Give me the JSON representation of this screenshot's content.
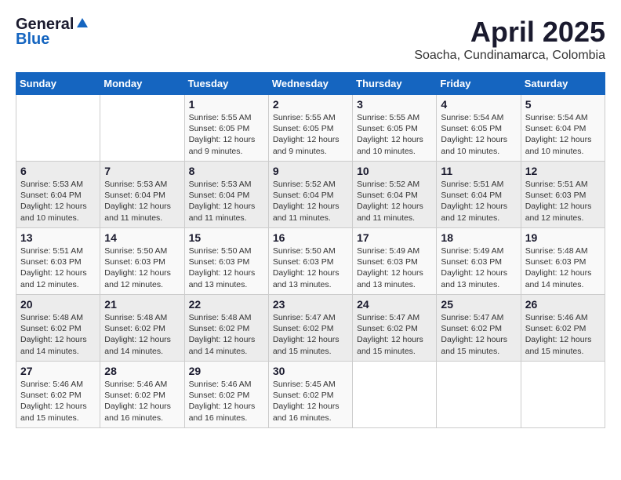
{
  "header": {
    "logo_general": "General",
    "logo_blue": "Blue",
    "title": "April 2025",
    "subtitle": "Soacha, Cundinamarca, Colombia"
  },
  "columns": [
    "Sunday",
    "Monday",
    "Tuesday",
    "Wednesday",
    "Thursday",
    "Friday",
    "Saturday"
  ],
  "weeks": [
    [
      {
        "day": "",
        "detail": ""
      },
      {
        "day": "",
        "detail": ""
      },
      {
        "day": "1",
        "detail": "Sunrise: 5:55 AM\nSunset: 6:05 PM\nDaylight: 12 hours\nand 9 minutes."
      },
      {
        "day": "2",
        "detail": "Sunrise: 5:55 AM\nSunset: 6:05 PM\nDaylight: 12 hours\nand 9 minutes."
      },
      {
        "day": "3",
        "detail": "Sunrise: 5:55 AM\nSunset: 6:05 PM\nDaylight: 12 hours\nand 10 minutes."
      },
      {
        "day": "4",
        "detail": "Sunrise: 5:54 AM\nSunset: 6:05 PM\nDaylight: 12 hours\nand 10 minutes."
      },
      {
        "day": "5",
        "detail": "Sunrise: 5:54 AM\nSunset: 6:04 PM\nDaylight: 12 hours\nand 10 minutes."
      }
    ],
    [
      {
        "day": "6",
        "detail": "Sunrise: 5:53 AM\nSunset: 6:04 PM\nDaylight: 12 hours\nand 10 minutes."
      },
      {
        "day": "7",
        "detail": "Sunrise: 5:53 AM\nSunset: 6:04 PM\nDaylight: 12 hours\nand 11 minutes."
      },
      {
        "day": "8",
        "detail": "Sunrise: 5:53 AM\nSunset: 6:04 PM\nDaylight: 12 hours\nand 11 minutes."
      },
      {
        "day": "9",
        "detail": "Sunrise: 5:52 AM\nSunset: 6:04 PM\nDaylight: 12 hours\nand 11 minutes."
      },
      {
        "day": "10",
        "detail": "Sunrise: 5:52 AM\nSunset: 6:04 PM\nDaylight: 12 hours\nand 11 minutes."
      },
      {
        "day": "11",
        "detail": "Sunrise: 5:51 AM\nSunset: 6:04 PM\nDaylight: 12 hours\nand 12 minutes."
      },
      {
        "day": "12",
        "detail": "Sunrise: 5:51 AM\nSunset: 6:03 PM\nDaylight: 12 hours\nand 12 minutes."
      }
    ],
    [
      {
        "day": "13",
        "detail": "Sunrise: 5:51 AM\nSunset: 6:03 PM\nDaylight: 12 hours\nand 12 minutes."
      },
      {
        "day": "14",
        "detail": "Sunrise: 5:50 AM\nSunset: 6:03 PM\nDaylight: 12 hours\nand 12 minutes."
      },
      {
        "day": "15",
        "detail": "Sunrise: 5:50 AM\nSunset: 6:03 PM\nDaylight: 12 hours\nand 13 minutes."
      },
      {
        "day": "16",
        "detail": "Sunrise: 5:50 AM\nSunset: 6:03 PM\nDaylight: 12 hours\nand 13 minutes."
      },
      {
        "day": "17",
        "detail": "Sunrise: 5:49 AM\nSunset: 6:03 PM\nDaylight: 12 hours\nand 13 minutes."
      },
      {
        "day": "18",
        "detail": "Sunrise: 5:49 AM\nSunset: 6:03 PM\nDaylight: 12 hours\nand 13 minutes."
      },
      {
        "day": "19",
        "detail": "Sunrise: 5:48 AM\nSunset: 6:03 PM\nDaylight: 12 hours\nand 14 minutes."
      }
    ],
    [
      {
        "day": "20",
        "detail": "Sunrise: 5:48 AM\nSunset: 6:02 PM\nDaylight: 12 hours\nand 14 minutes."
      },
      {
        "day": "21",
        "detail": "Sunrise: 5:48 AM\nSunset: 6:02 PM\nDaylight: 12 hours\nand 14 minutes."
      },
      {
        "day": "22",
        "detail": "Sunrise: 5:48 AM\nSunset: 6:02 PM\nDaylight: 12 hours\nand 14 minutes."
      },
      {
        "day": "23",
        "detail": "Sunrise: 5:47 AM\nSunset: 6:02 PM\nDaylight: 12 hours\nand 15 minutes."
      },
      {
        "day": "24",
        "detail": "Sunrise: 5:47 AM\nSunset: 6:02 PM\nDaylight: 12 hours\nand 15 minutes."
      },
      {
        "day": "25",
        "detail": "Sunrise: 5:47 AM\nSunset: 6:02 PM\nDaylight: 12 hours\nand 15 minutes."
      },
      {
        "day": "26",
        "detail": "Sunrise: 5:46 AM\nSunset: 6:02 PM\nDaylight: 12 hours\nand 15 minutes."
      }
    ],
    [
      {
        "day": "27",
        "detail": "Sunrise: 5:46 AM\nSunset: 6:02 PM\nDaylight: 12 hours\nand 15 minutes."
      },
      {
        "day": "28",
        "detail": "Sunrise: 5:46 AM\nSunset: 6:02 PM\nDaylight: 12 hours\nand 16 minutes."
      },
      {
        "day": "29",
        "detail": "Sunrise: 5:46 AM\nSunset: 6:02 PM\nDaylight: 12 hours\nand 16 minutes."
      },
      {
        "day": "30",
        "detail": "Sunrise: 5:45 AM\nSunset: 6:02 PM\nDaylight: 12 hours\nand 16 minutes."
      },
      {
        "day": "",
        "detail": ""
      },
      {
        "day": "",
        "detail": ""
      },
      {
        "day": "",
        "detail": ""
      }
    ]
  ]
}
